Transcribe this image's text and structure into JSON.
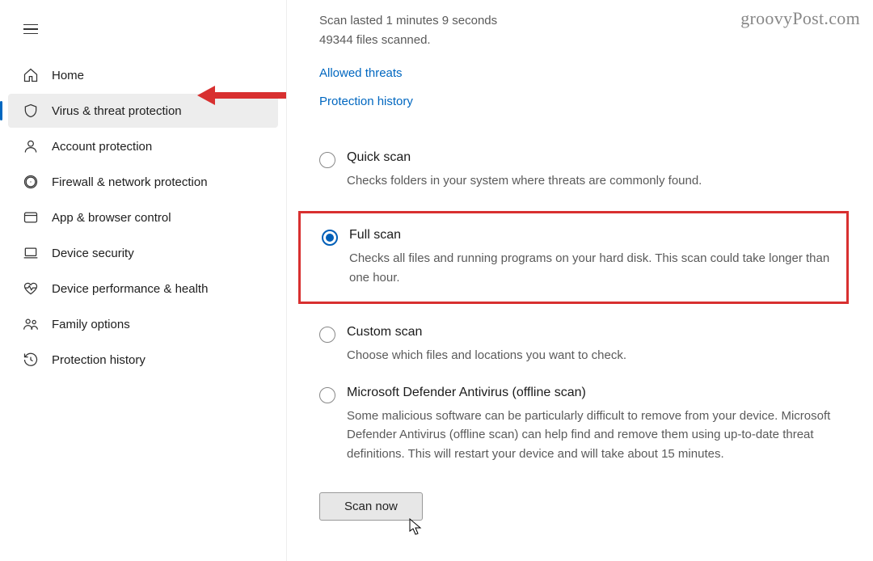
{
  "watermark": "groovyPost.com",
  "sidebar": {
    "items": [
      {
        "id": "home",
        "label": "Home"
      },
      {
        "id": "virus",
        "label": "Virus & threat protection"
      },
      {
        "id": "account",
        "label": "Account protection"
      },
      {
        "id": "firewall",
        "label": "Firewall & network protection"
      },
      {
        "id": "appbrowser",
        "label": "App & browser control"
      },
      {
        "id": "devicesec",
        "label": "Device security"
      },
      {
        "id": "perfhealth",
        "label": "Device performance & health"
      },
      {
        "id": "family",
        "label": "Family options"
      },
      {
        "id": "history",
        "label": "Protection history"
      }
    ],
    "active_index": 1
  },
  "scan_meta": {
    "line1": "Scan lasted 1 minutes 9 seconds",
    "line2": "49344 files scanned."
  },
  "links": {
    "allowed": "Allowed threats",
    "history": "Protection history"
  },
  "options": [
    {
      "id": "quick",
      "title": "Quick scan",
      "desc": "Checks folders in your system where threats are commonly found.",
      "checked": false,
      "highlighted": false
    },
    {
      "id": "full",
      "title": "Full scan",
      "desc": "Checks all files and running programs on your hard disk. This scan could take longer than one hour.",
      "checked": true,
      "highlighted": true
    },
    {
      "id": "custom",
      "title": "Custom scan",
      "desc": "Choose which files and locations you want to check.",
      "checked": false,
      "highlighted": false
    },
    {
      "id": "offline",
      "title": "Microsoft Defender Antivirus (offline scan)",
      "desc": "Some malicious software can be particularly difficult to remove from your device. Microsoft Defender Antivirus (offline scan) can help find and remove them using up-to-date threat definitions. This will restart your device and will take about 15 minutes.",
      "checked": false,
      "highlighted": false
    }
  ],
  "scan_button": "Scan now"
}
